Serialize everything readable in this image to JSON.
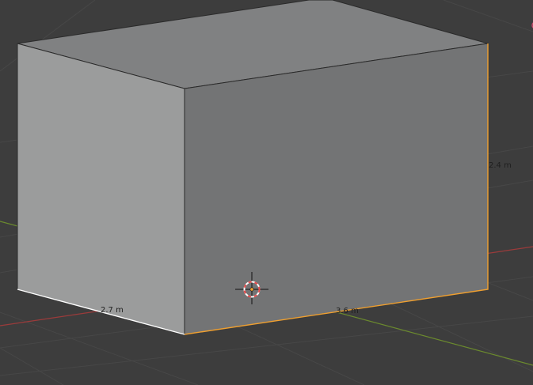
{
  "viewport": {
    "background_color": "#3d3d3d",
    "grid_color": "#474747",
    "x_axis_color": "#9b3b3b",
    "y_axis_color": "#6b8a2e"
  },
  "cube": {
    "top_face_color": "#808182",
    "left_face_color": "#9b9c9c",
    "front_face_color": "#737475",
    "selected_edge_color": "#f0a030",
    "highlight_edge_color": "#ffffff"
  },
  "measurements": {
    "height": "2.4 m",
    "width": "3.6 m",
    "depth": "2.7 m"
  },
  "cursor": {
    "icon": "3d-cursor-icon",
    "ring_red": "#e84a4a",
    "ring_white": "#ffffff",
    "center_color": "#f0a030"
  }
}
